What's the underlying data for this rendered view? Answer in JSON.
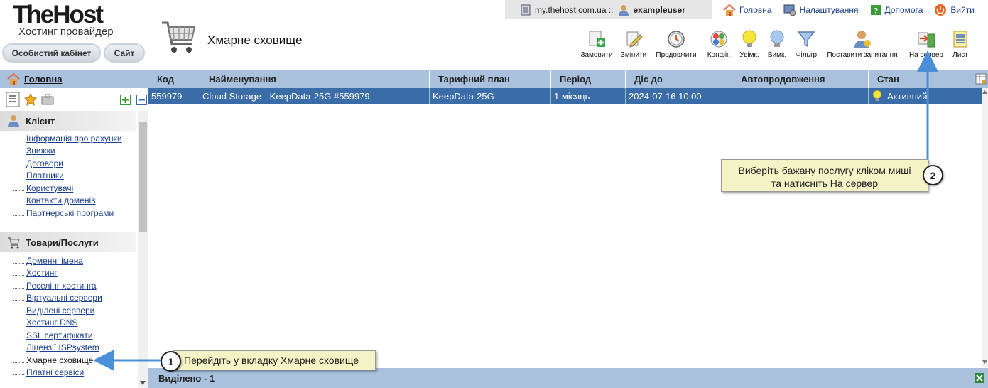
{
  "brand": {
    "name": "TheHost",
    "tagline": "Хостинг провайдер"
  },
  "header_buttons": {
    "cabinet": "Особистий кабінет",
    "site": "Сайт"
  },
  "page_title": "Хмарне сховище",
  "topbar": {
    "domain": "my.thehost.com.ua ::",
    "user": "exampleuser"
  },
  "top_links": [
    {
      "label": "Головна",
      "icon": "home-icon"
    },
    {
      "label": "Налаштування",
      "icon": "settings-icon"
    },
    {
      "label": "Допомога",
      "icon": "help-icon"
    },
    {
      "label": "Вийти",
      "icon": "logout-icon"
    }
  ],
  "toolbar": [
    {
      "label": "Замовити",
      "icon": "order-icon"
    },
    {
      "label": "Змінити",
      "icon": "edit-icon"
    },
    {
      "label": "Продовжити",
      "icon": "renew-icon"
    },
    {
      "label": "Конфіг.",
      "icon": "config-icon"
    },
    {
      "label": "Увімк.",
      "icon": "bulb-on-icon"
    },
    {
      "label": "Вимк.",
      "icon": "bulb-off-icon"
    },
    {
      "label": "Фільтр",
      "icon": "filter-icon"
    },
    {
      "label": "Поставити запитання",
      "icon": "ask-question-icon"
    },
    {
      "label": "На сервер",
      "icon": "to-server-icon"
    },
    {
      "label": "Лист",
      "icon": "letter-icon"
    }
  ],
  "sidebar": {
    "home": "Головна",
    "client": {
      "title": "Клієнт",
      "items": [
        "Інформація про рахунки",
        "Знижки",
        "Договори",
        "Платники",
        "Користувачі",
        "Контакти доменів",
        "Партнерські програми"
      ]
    },
    "goods": {
      "title": "Товари/Послуги",
      "items": [
        "Доменні імена",
        "Хостинг",
        "Реселінг хостинга",
        "Віртуальні сервери",
        "Виділені сервери",
        "Хостинг DNS",
        "SSL сертифікати",
        "Ліцензії ISPsystem",
        "Хмарне сховище",
        "Платні сервіси"
      ]
    }
  },
  "table": {
    "columns": [
      "Код",
      "Найменування",
      "Тарифний план",
      "Період",
      "Діє до",
      "Автопродовження",
      "Стан"
    ],
    "rows": [
      [
        "559979",
        "Cloud Storage - KeepData-25G #559979",
        "KeepData-25G",
        "1 місяць",
        "2024-07-16 10:00",
        "-",
        "Активний"
      ]
    ],
    "footer": "Виділено - 1"
  },
  "callouts": [
    {
      "num": "1",
      "text": "Перейдіть у вкладку Хмарне сховище"
    },
    {
      "num": "2",
      "line1": "Виберіть бажану послугу кліком миші",
      "line2": "та натисніть На сервер"
    }
  ],
  "colors": {
    "header_blue": "#a9c1dd",
    "row_selected": "#3a6da8",
    "link": "#1a3f8c",
    "callout_bg": "#f3f3c5",
    "arrow": "#4a90d9"
  }
}
